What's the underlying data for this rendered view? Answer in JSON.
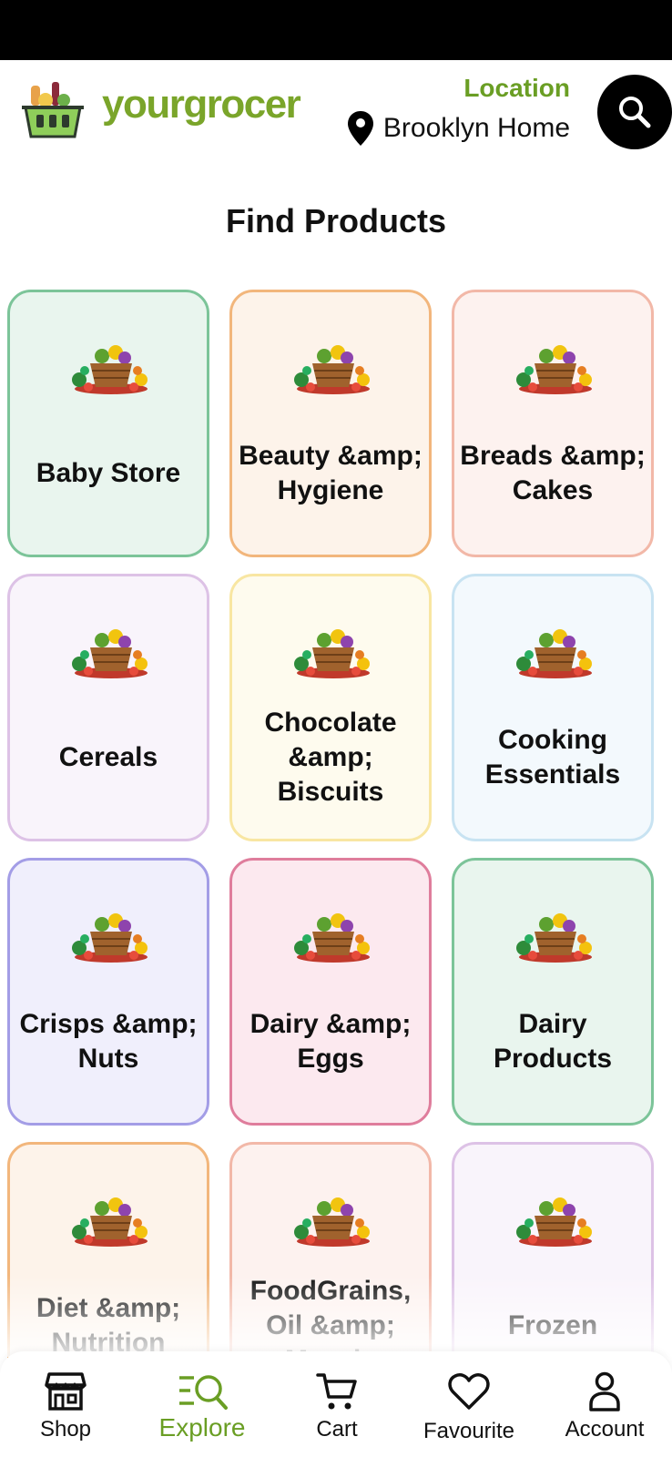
{
  "header": {
    "brand": "yourgrocer",
    "location_label": "Location",
    "location_value": "Brooklyn Home"
  },
  "page": {
    "title": "Find Products"
  },
  "categories": [
    {
      "label": "Baby Store",
      "bg": "#e9f5ee",
      "border": "#7cc499"
    },
    {
      "label": "Beauty &amp; Hygiene",
      "bg": "#fdf3ea",
      "border": "#f2b67c"
    },
    {
      "label": "Breads &amp; Cakes",
      "bg": "#fdf2ef",
      "border": "#f2b8a8"
    },
    {
      "label": "Cereals",
      "bg": "#f9f4fb",
      "border": "#ddc2e6"
    },
    {
      "label": "Chocolate &amp; Biscuits",
      "bg": "#fefbee",
      "border": "#f8e6a2"
    },
    {
      "label": "Cooking Essentials",
      "bg": "#f3f9fd",
      "border": "#c8e3f2"
    },
    {
      "label": "Crisps &amp; Nuts",
      "bg": "#f0effc",
      "border": "#a39de6"
    },
    {
      "label": "Dairy &amp; Eggs",
      "bg": "#fce9ef",
      "border": "#df7d9c"
    },
    {
      "label": "Dairy Products",
      "bg": "#e9f5ee",
      "border": "#7cc499"
    },
    {
      "label": "Diet &amp; Nutrition",
      "bg": "#fdf3ea",
      "border": "#f2b67c"
    },
    {
      "label": "FoodGrains, Oil &amp; Masala",
      "bg": "#fdf2ef",
      "border": "#f2b8a8"
    },
    {
      "label": "Frozen",
      "bg": "#f9f4fb",
      "border": "#ddc2e6"
    }
  ],
  "nav": {
    "shop": "Shop",
    "explore": "Explore",
    "cart": "Cart",
    "favourite": "Favourite",
    "account": "Account",
    "active_color": "#6a9e24"
  },
  "colors": {
    "brand_green": "#7aa52a",
    "location_green": "#6a9e24"
  }
}
